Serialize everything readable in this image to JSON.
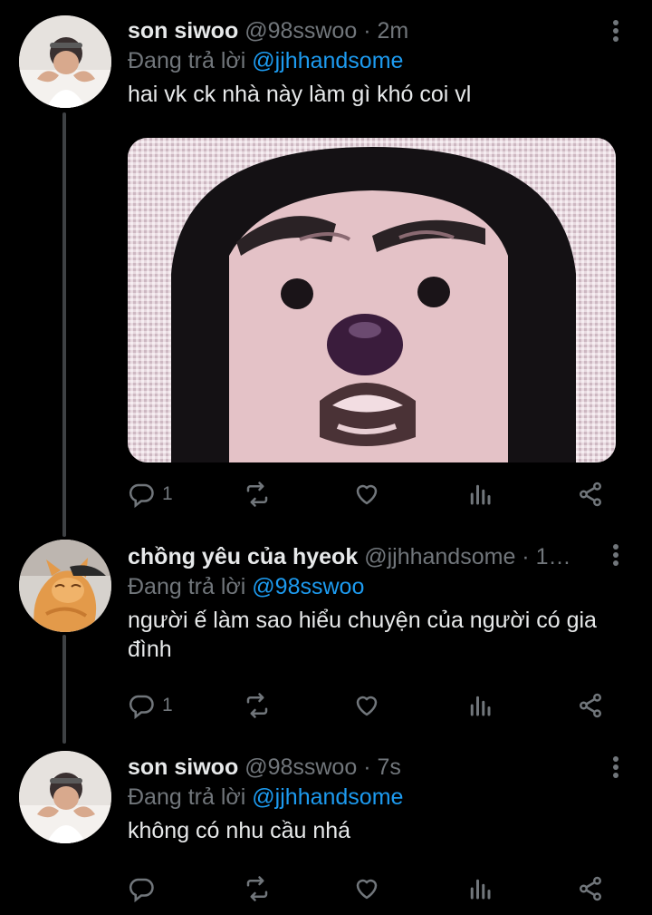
{
  "tweets": [
    {
      "name": "son siwoo",
      "handle": "@98sswoo",
      "separator": "·",
      "time": "2m",
      "replying_prefix": "Đang trả lời",
      "replying_to": "@jjhhandsome",
      "text": "hai vk ck nhà này làm gì khó coi vl",
      "has_media": true,
      "reply_count": "1",
      "avatar": "user-photo-heart-hands"
    },
    {
      "name": "chồng yêu của hyeok",
      "handle": "@jjhhandsome",
      "separator": "·",
      "time": "1…",
      "replying_prefix": "Đang trả lời",
      "replying_to": "@98sswoo",
      "text": "người ế làm sao hiểu chuyện của người có gia đình",
      "has_media": false,
      "reply_count": "1",
      "avatar": "orange-cat-photo"
    },
    {
      "name": "son siwoo",
      "handle": "@98sswoo",
      "separator": "·",
      "time": "7s",
      "replying_prefix": "Đang trả lời",
      "replying_to": "@jjhhandsome",
      "text": "không có nhu cầu nhá",
      "has_media": false,
      "reply_count": "",
      "avatar": "user-photo-heart-hands"
    }
  ],
  "colors": {
    "background": "#000000",
    "primary_text": "#e7e9ea",
    "secondary_text": "#71767b",
    "accent": "#1d9bf0",
    "thread_line": "#3e4144"
  },
  "icons": [
    "reply-icon",
    "retweet-icon",
    "like-icon",
    "analytics-icon",
    "share-icon",
    "more-options-icon"
  ]
}
